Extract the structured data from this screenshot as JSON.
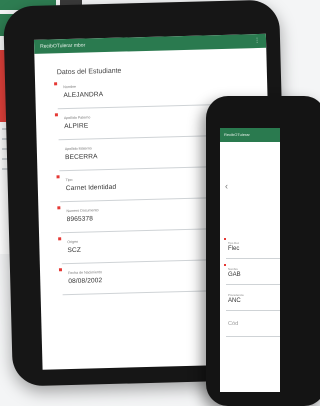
{
  "colors": {
    "appbar": "#2a7a4f",
    "required_marker": "#e53935",
    "device_frame": "#161616"
  },
  "screen1": {
    "app_title": "RecibOTulerar mbor",
    "menu_icon": "more-vert-icon",
    "section_title": "Datos del Estudiante",
    "fields": [
      {
        "label": "Nombre",
        "value": "ALEJANDRA",
        "required": true
      },
      {
        "label": "Apellido Paterno",
        "value": "ALPIRE",
        "required": true
      },
      {
        "label": "Apellido Materno",
        "value": "BECERRA",
        "required": false
      },
      {
        "label": "Tipo",
        "value": "Carnet Identidad",
        "required": true
      },
      {
        "label": "Numero Documento",
        "value": "8965378",
        "required": true
      },
      {
        "label": "Origen",
        "value": "SCZ",
        "required": true
      },
      {
        "label": "Fecha de Nacimiento",
        "value": "08/08/2002",
        "required": true
      }
    ]
  },
  "screen2": {
    "app_title": "RecibOTulerar",
    "back_icon": "chevron-left-icon",
    "fields": [
      {
        "label": "Tipo Doc",
        "value": "Flec",
        "required": true
      },
      {
        "label": "Nombre",
        "value": "GAB",
        "required": true
      },
      {
        "label": "Procedencia",
        "value": "ANC",
        "required": false
      },
      {
        "label": "",
        "value": "Cód",
        "required": false
      }
    ]
  }
}
